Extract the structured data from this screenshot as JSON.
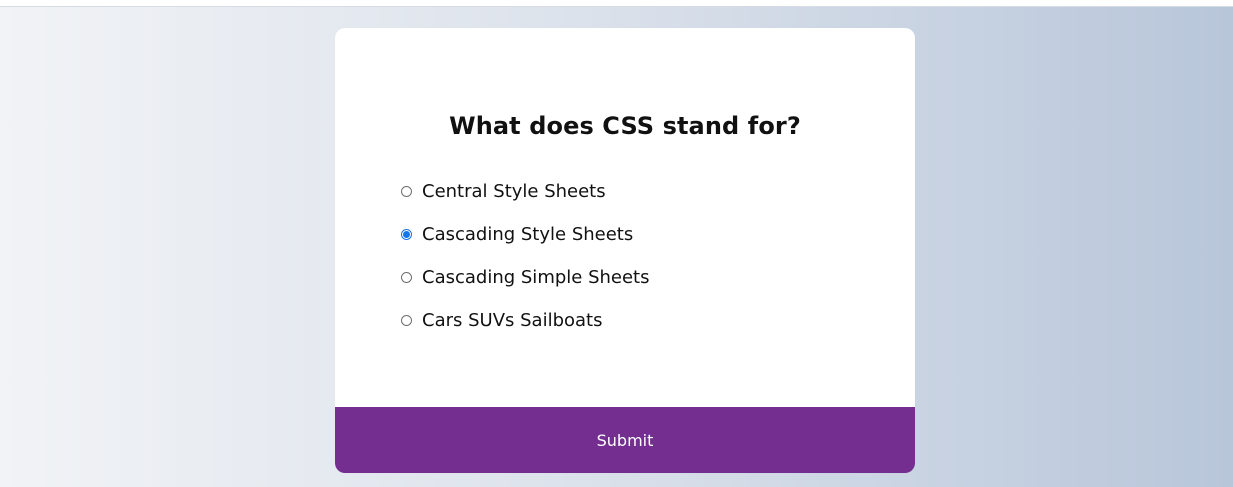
{
  "quiz": {
    "question": "What does CSS stand for?",
    "options": [
      {
        "label": "Central Style Sheets",
        "selected": false
      },
      {
        "label": "Cascading Style Sheets",
        "selected": true
      },
      {
        "label": "Cascading Simple Sheets",
        "selected": false
      },
      {
        "label": "Cars SUVs Sailboats",
        "selected": false
      }
    ],
    "submit_label": "Submit"
  },
  "colors": {
    "accent_purple": "#732e8f",
    "selected_blue": "#1a73e8"
  }
}
